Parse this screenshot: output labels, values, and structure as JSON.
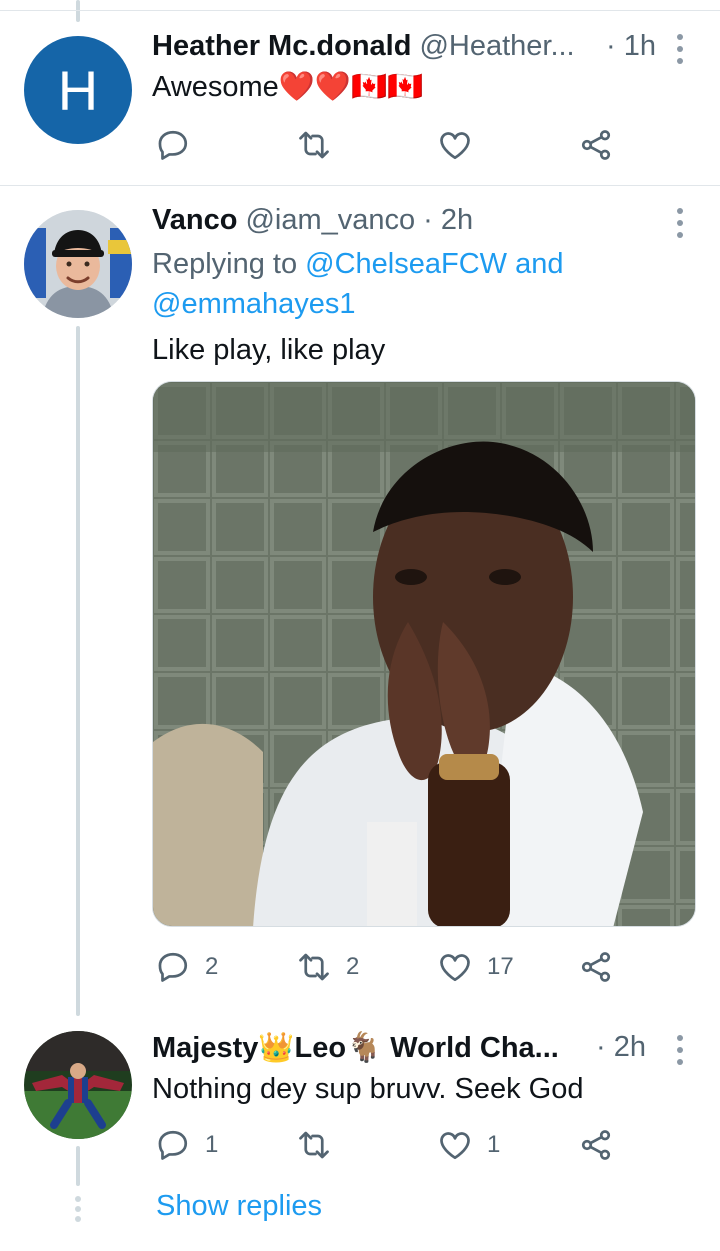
{
  "tweets": [
    {
      "avatar_letter": "H",
      "name": "Heather Mc.donald",
      "handle": "@Heather...",
      "time": "· 1h",
      "text": "Awesome❤️❤️🇨🇦🇨🇦",
      "actions": {
        "reply": "",
        "retweet": "",
        "like": ""
      }
    },
    {
      "name": "Vanco",
      "handle": "@iam_vanco",
      "time": "· 2h",
      "replying_prefix": "Replying to",
      "replying_handle_1": "@ChelseaFCW",
      "replying_and": "and",
      "replying_handle_2": "@emmahayes1",
      "text": "Like play, like play",
      "actions": {
        "reply": "2",
        "retweet": "2",
        "like": "17"
      }
    },
    {
      "name": "Majesty👑Leo🐐 World Cha...",
      "time": "· 2h",
      "text": "Nothing dey sup bruvv. Seek God",
      "actions": {
        "reply": "1",
        "retweet": "",
        "like": "1"
      }
    }
  ],
  "show_replies": "Show replies",
  "colors": {
    "accent": "#1d9bf0",
    "muted": "#536471",
    "avatar_h": "#1565a8",
    "thread_line": "#cfd9de"
  },
  "icons": [
    "reply-icon",
    "retweet-icon",
    "like-icon",
    "share-icon",
    "more-icon"
  ]
}
